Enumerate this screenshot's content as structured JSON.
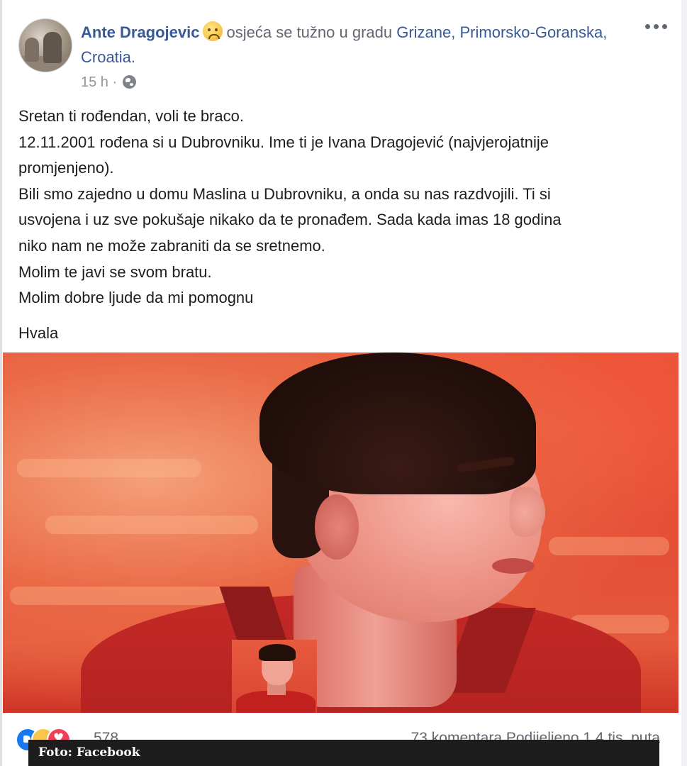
{
  "post": {
    "author": "Ante Dragojevic",
    "feeling_text": "osjeća se tužno u gradu",
    "location": "Grizane, Primorsko-Goranska, Croatia.",
    "timestamp": "15 h",
    "separator": "·",
    "privacy_icon": "globe-icon",
    "body_lines": [
      "Sretan ti rođendan, voli te braco.",
      "12.11.2001 rođena si u Dubrovniku. Ime ti je Ivana Dragojević (najvjerojatnije",
      "promjenjeno).",
      "Bili smo zajedno u domu Maslina u Dubrovniku, a onda su nas razdvojili. Ti si",
      "usvojena i uz sve pokušaje nikako da te pronađem. Sada kada imas 18 godina",
      "niko nam ne može zabraniti da se sretnemo.",
      "Molim te javi se svom bratu.",
      "Molim dobre ljude da mi pomognu"
    ],
    "closing": "Hvala"
  },
  "footer": {
    "reaction_icons": [
      "like-icon",
      "wow-icon",
      "love-icon"
    ],
    "reaction_count": "578",
    "comments_shares": "73 komentara  Podijeljeno 1,4 tis. puta"
  },
  "photo_credit": "Foto: Facebook",
  "colors": {
    "link": "#385898",
    "meta": "#90949c",
    "text": "#1c1e21",
    "credit_bar": "#1d1d1d"
  }
}
